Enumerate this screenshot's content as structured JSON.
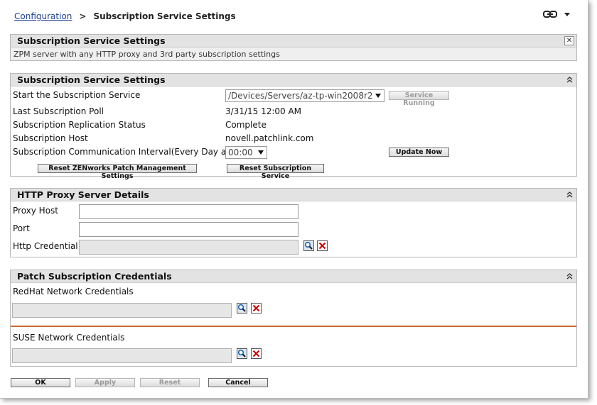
{
  "breadcrumb": {
    "root": "Configuration",
    "separator": ">",
    "current": "Subscription Service Settings"
  },
  "desc_panel": {
    "title": "Subscription Service Settings",
    "text": "ZPM server with any HTTP proxy and 3rd party subscription settings",
    "close_symbol": "✕"
  },
  "subscription": {
    "title": "Subscription Service Settings",
    "start_label": "Start the Subscription Service",
    "start_value": "/Devices/Servers/az-tp-win2008r2",
    "status_button": "Service Running",
    "poll_label": "Last Subscription Poll",
    "poll_value": "3/31/15 12:00 AM",
    "replication_label": "Subscription Replication Status",
    "replication_value": "Complete",
    "host_label": "Subscription Host",
    "host_value": "novell.patchlink.com",
    "interval_label": "Subscription Communication Interval(Every Day at)",
    "interval_value": "00:00",
    "update_button": "Update Now",
    "reset_zpm_button": "Reset ZENworks Patch Management Settings",
    "reset_service_button": "Reset Subscription Service"
  },
  "proxy": {
    "title": "HTTP Proxy Server Details",
    "host_label": "Proxy Host",
    "host_value": "",
    "port_label": "Port",
    "port_value": "",
    "credential_label": "Http Credential"
  },
  "patch": {
    "title": "Patch Subscription Credentials",
    "redhat_label": "RedHat Network Credentials",
    "suse_label": "SUSE Network Credentials"
  },
  "footer": {
    "ok": "OK",
    "apply": "Apply",
    "reset": "Reset",
    "cancel": "Cancel"
  },
  "icons": {
    "link": "link-icon",
    "menu": "chevron-down-icon",
    "close": "close-icon",
    "collapse": "collapse-up-icon",
    "search": "search-icon",
    "clear": "clear-x-icon"
  },
  "colors": {
    "link": "#1f3f96",
    "divider": "#c96a2e",
    "clear_icon": "#cc0000",
    "search_icon": "#1a5fb4"
  }
}
